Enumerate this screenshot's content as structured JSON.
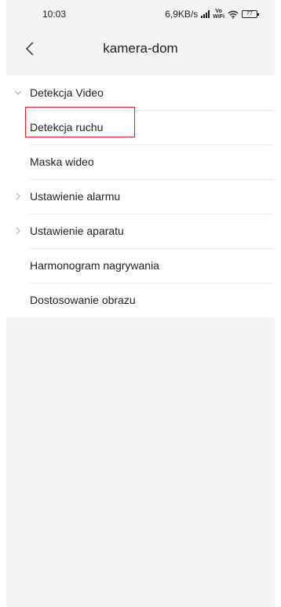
{
  "status_bar": {
    "time": "10:03",
    "network_speed": "6,9KB/s",
    "battery_level": "77",
    "vowifi": "Vo WiFi"
  },
  "header": {
    "title": "kamera-dom"
  },
  "menu": {
    "items": [
      {
        "label": "Detekcja Video",
        "expander": "chevron-down-icon"
      },
      {
        "label": "Detekcja ruchu",
        "highlighted": true
      },
      {
        "label": "Maska wideo"
      },
      {
        "label": "Ustawienie alarmu",
        "expander": "chevron-right-icon"
      },
      {
        "label": "Ustawienie aparatu",
        "expander": "chevron-right-icon"
      },
      {
        "label": "Harmonogram nagrywania"
      },
      {
        "label": "Dostosowanie obrazu"
      }
    ]
  },
  "colors": {
    "background": "#f3f3f3",
    "list_background": "#ffffff",
    "highlight": "#d9262c",
    "chevron": "#b0b0b0"
  }
}
